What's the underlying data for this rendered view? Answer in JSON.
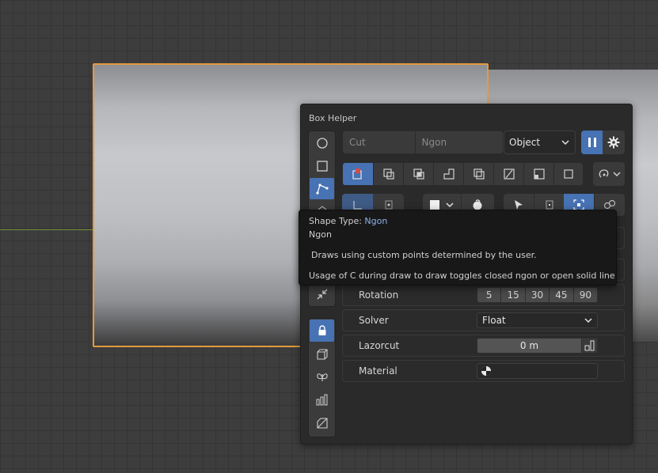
{
  "panel": {
    "title": "Box Helper"
  },
  "toolbar": {
    "mode_field": "Cut",
    "shape_field": "Ngon",
    "target_select": "Object"
  },
  "tooltip": {
    "prefix": "Shape Type: ",
    "highlight": "Ngon",
    "name": "Ngon",
    "description": "Draws using custom points determined by the user.",
    "usage": "Usage of C during draw to draw toggles closed ngon or open solid line"
  },
  "settings": {
    "rotation": {
      "label": "Rotation",
      "options": [
        "5",
        "15",
        "30",
        "45",
        "90"
      ]
    },
    "solver": {
      "label": "Solver",
      "value": "Float"
    },
    "lazorcut": {
      "label": "Lazorcut",
      "value": "0 m"
    },
    "material": {
      "label": "Material"
    }
  },
  "colors": {
    "accent": "#4772b3",
    "selection": "#e69a3c",
    "panel_bg": "#2a2a2a"
  }
}
